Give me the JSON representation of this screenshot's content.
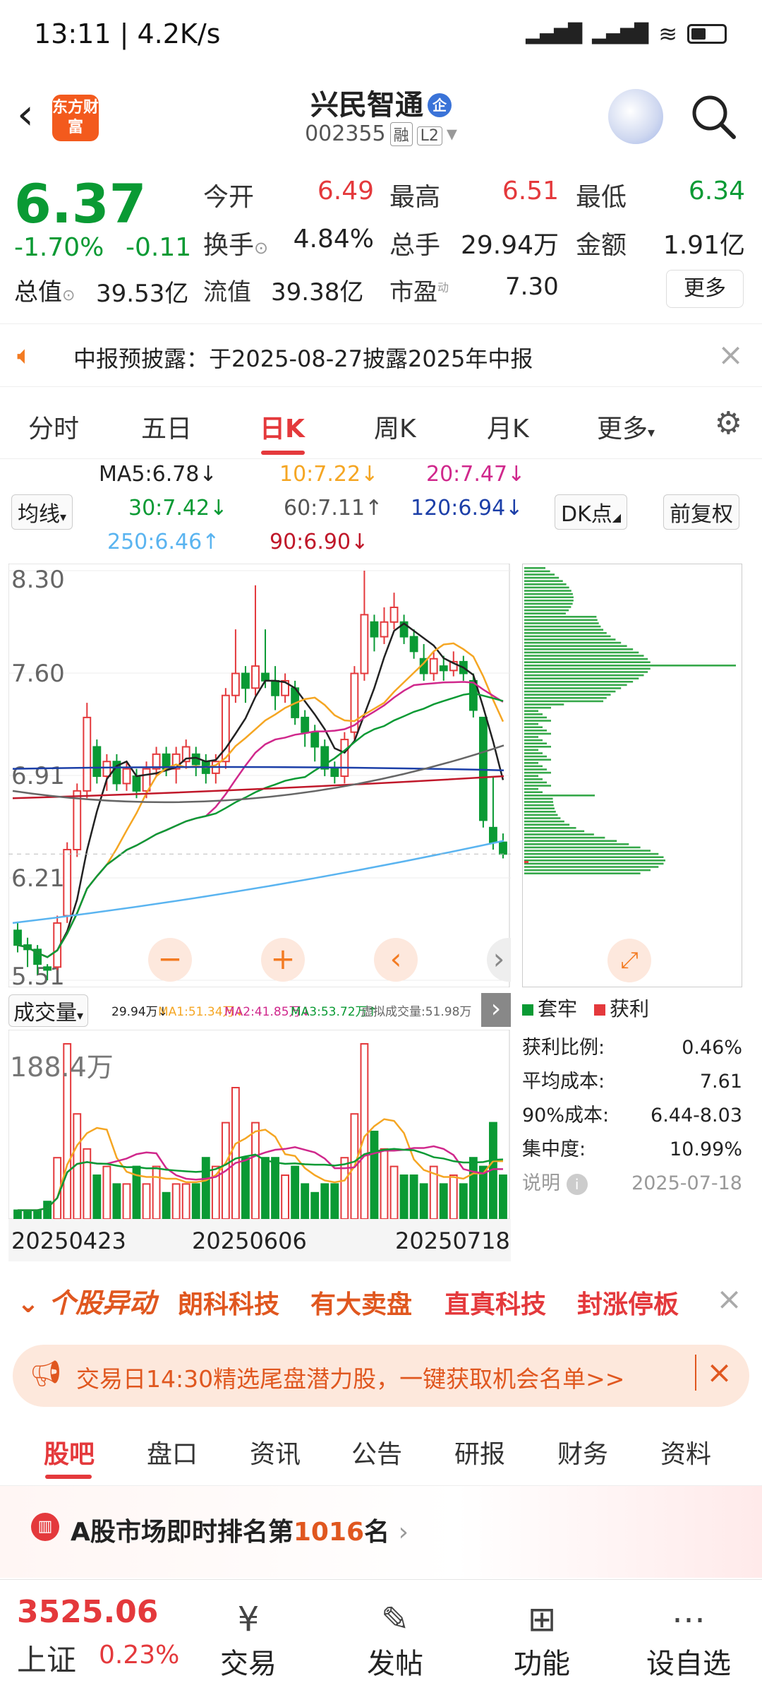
{
  "status": {
    "time": "13:11 | 4.2K/s",
    "net": "HD",
    "battery": "▭"
  },
  "header": {
    "title": "兴民智通",
    "badge": "企",
    "code": "002355",
    "tag1": "融",
    "tag2": "L2",
    "logo": "东方财富"
  },
  "quote": {
    "price": "6.37",
    "change_pct": "-1.70%",
    "change": "-0.11",
    "open_label": "今开",
    "open": "6.49",
    "high_label": "最高",
    "high": "6.51",
    "low_label": "最低",
    "low": "6.34",
    "turnover_label": "换手",
    "turnover": "4.84%",
    "volume_label": "总手",
    "volume": "29.94万",
    "amount_label": "金额",
    "amount": "1.91亿",
    "cap_label": "总值",
    "cap": "39.53亿",
    "float_label": "流值",
    "float": "39.38亿",
    "pe_label": "市盈",
    "pe_sup": "动",
    "pe": "7.30",
    "more": "更多"
  },
  "notice": {
    "text": "中报预披露：于2025-08-27披露2025年中报"
  },
  "tabs": [
    "分时",
    "五日",
    "日K",
    "周K",
    "月K",
    "更多"
  ],
  "ma": {
    "ma5": "MA5:6.78↓",
    "ma10": "10:7.22↓",
    "ma20": "20:7.47↓",
    "ma30": "30:7.42↓",
    "ma60": "60:7.11↑",
    "ma120": "120:6.94↓",
    "ma250": "250:6.46↑",
    "ma90": "90:6.90↓",
    "line_btn": "均线",
    "dk_btn": "DK点",
    "fq_btn": "前复权",
    "colors": {
      "ma5": "#222222",
      "ma10": "#f5a623",
      "ma20": "#d0288c",
      "ma30": "#0a9a34",
      "ma60": "#666666",
      "ma120": "#1c3fa8",
      "ma250": "#5ab4f0",
      "ma90": "#c0182a"
    }
  },
  "chart_data": {
    "type": "candlestick",
    "y_ticks": [
      "8.30",
      "7.60",
      "6.91",
      "6.21",
      "5.51"
    ],
    "ylim": [
      5.51,
      8.3
    ],
    "candles": [
      [
        5.85,
        5.75,
        5.9,
        5.7
      ],
      [
        5.75,
        5.72,
        5.8,
        5.6
      ],
      [
        5.72,
        5.62,
        5.75,
        5.55
      ],
      [
        5.6,
        5.58,
        5.62,
        5.51
      ],
      [
        5.6,
        5.9,
        5.95,
        5.58
      ],
      [
        5.95,
        6.4,
        6.45,
        5.9
      ],
      [
        6.4,
        6.8,
        6.85,
        6.35
      ],
      [
        6.8,
        7.3,
        7.4,
        6.75
      ],
      [
        7.1,
        6.9,
        7.15,
        6.85
      ],
      [
        6.9,
        7.0,
        7.05,
        6.8
      ],
      [
        7.0,
        6.85,
        7.05,
        6.8
      ],
      [
        6.85,
        6.95,
        7.0,
        6.8
      ],
      [
        6.9,
        6.8,
        6.95,
        6.75
      ],
      [
        6.8,
        6.95,
        7.0,
        6.75
      ],
      [
        6.95,
        7.05,
        7.1,
        6.9
      ],
      [
        7.05,
        6.95,
        7.1,
        6.9
      ],
      [
        6.95,
        7.05,
        7.1,
        6.85
      ],
      [
        7.0,
        7.1,
        7.15,
        6.95
      ],
      [
        7.05,
        6.98,
        7.1,
        6.9
      ],
      [
        7.0,
        6.92,
        7.05,
        6.85
      ],
      [
        6.92,
        7.0,
        7.05,
        6.85
      ],
      [
        7.0,
        7.45,
        7.5,
        6.95
      ],
      [
        7.45,
        7.6,
        7.9,
        7.4
      ],
      [
        7.6,
        7.5,
        7.65,
        7.4
      ],
      [
        7.5,
        7.65,
        8.2,
        7.45
      ],
      [
        7.6,
        7.55,
        7.9,
        7.5
      ],
      [
        7.55,
        7.45,
        7.65,
        7.35
      ],
      [
        7.45,
        7.55,
        7.6,
        7.4
      ],
      [
        7.5,
        7.3,
        7.55,
        7.25
      ],
      [
        7.3,
        7.2,
        7.35,
        7.1
      ],
      [
        7.2,
        7.1,
        7.25,
        7.0
      ],
      [
        7.1,
        6.95,
        7.15,
        6.9
      ],
      [
        6.95,
        6.9,
        7.0,
        6.85
      ],
      [
        6.9,
        7.15,
        7.2,
        6.85
      ],
      [
        7.2,
        7.6,
        7.65,
        7.15
      ],
      [
        7.6,
        8.0,
        8.3,
        7.55
      ],
      [
        7.95,
        7.85,
        8.0,
        7.75
      ],
      [
        7.85,
        7.95,
        8.05,
        7.8
      ],
      [
        7.95,
        8.05,
        8.15,
        7.9
      ],
      [
        7.95,
        7.85,
        8.0,
        7.8
      ],
      [
        7.85,
        7.75,
        7.9,
        7.7
      ],
      [
        7.7,
        7.6,
        7.8,
        7.55
      ],
      [
        7.6,
        7.7,
        7.75,
        7.55
      ],
      [
        7.65,
        7.62,
        7.72,
        7.55
      ],
      [
        7.62,
        7.68,
        7.75,
        7.58
      ],
      [
        7.68,
        7.6,
        7.72,
        7.55
      ],
      [
        7.55,
        7.35,
        7.6,
        7.3
      ],
      [
        7.3,
        6.6,
        7.3,
        6.55
      ],
      [
        6.55,
        6.45,
        6.9,
        6.4
      ],
      [
        6.45,
        6.37,
        6.51,
        6.34
      ]
    ]
  },
  "nav": {
    "zoom_out": "−",
    "zoom_in": "+",
    "prev": "‹",
    "next": "›",
    "fullscreen": "⤢"
  },
  "volume": {
    "label": "成交量",
    "values_text": "29.94万↓",
    "ma1": "MA1:51.34万↓",
    "ma2": "MA2:41.85万↓",
    "ma3": "MA3:53.72万↑",
    "virtual": "虚拟成交量:51.98万",
    "ymax": "188.4万",
    "dates": [
      "20250423",
      "20250606",
      "20250718"
    ],
    "bars": [
      0.05,
      0.05,
      0.05,
      0.1,
      0.35,
      1.0,
      0.6,
      0.4,
      0.25,
      0.3,
      0.2,
      0.2,
      0.3,
      0.2,
      0.3,
      0.15,
      0.2,
      0.2,
      0.2,
      0.35,
      0.3,
      0.55,
      0.75,
      0.35,
      0.55,
      0.35,
      0.35,
      0.25,
      0.3,
      0.2,
      0.15,
      0.2,
      0.2,
      0.35,
      0.6,
      1.0,
      0.5,
      0.4,
      0.3,
      0.25,
      0.25,
      0.2,
      0.3,
      0.2,
      0.25,
      0.2,
      0.35,
      0.3,
      0.55,
      0.25
    ]
  },
  "profile": {
    "legend_hold": "套牢",
    "legend_profit": "获利",
    "profit_ratio_label": "获利比例:",
    "profit_ratio": "0.46%",
    "avg_cost_label": "平均成本:",
    "avg_cost": "7.61",
    "cost90_label": "90%成本:",
    "cost90": "6.44-8.03",
    "concentration_label": "集中度:",
    "concentration": "10.99%",
    "note_label": "说明",
    "date": "2025-07-18"
  },
  "movers": {
    "label": "个股异动",
    "items": [
      "朗科科技",
      "有大卖盘",
      "直真科技",
      "封涨停板"
    ]
  },
  "banner": {
    "text": "交易日14:30精选尾盘潜力股，一键获取机会名单>>"
  },
  "subtabs": [
    "股吧",
    "盘口",
    "资讯",
    "公告",
    "研报",
    "财务",
    "资料"
  ],
  "rank": {
    "pre": "A股市场即时排名第",
    "num": "1016",
    "post": "名"
  },
  "bottom": {
    "index_value": "3525.06",
    "index_name": "上证",
    "index_chg": "0.23%",
    "items": [
      {
        "icon": "¥",
        "label": "交易"
      },
      {
        "icon": "✎",
        "label": "发帖"
      },
      {
        "icon": "⊞",
        "label": "功能"
      },
      {
        "icon": "⋯",
        "label": "设自选"
      }
    ]
  }
}
